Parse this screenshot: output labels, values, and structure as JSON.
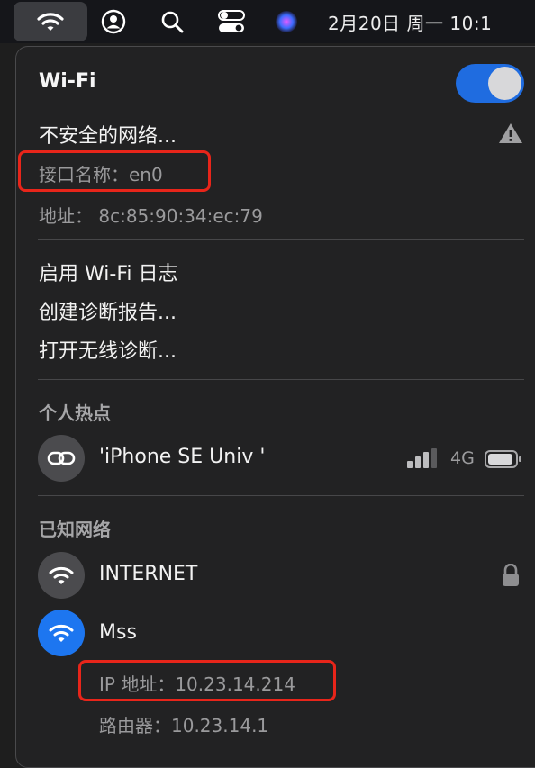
{
  "menubar": {
    "clock": "2月20日 周一  10:1",
    "icons": [
      "wifi-icon",
      "user-icon",
      "search-icon",
      "control-center-icon",
      "siri-icon"
    ]
  },
  "wifi": {
    "title": "Wi-Fi",
    "toggle_on": true,
    "insecure": "不安全的网络...",
    "interface_label": "接口名称：",
    "interface_value": "en0",
    "address_label": "地址：",
    "address_value": "8c:85:90:34:ec:79"
  },
  "actions": [
    {
      "label": "启用 Wi-Fi 日志"
    },
    {
      "label": "创建诊断报告..."
    },
    {
      "label": "打开无线诊断..."
    }
  ],
  "hotspot": {
    "section": "个人热点",
    "name": "'iPhone SE Univ '",
    "network_type": "4G",
    "signal_bars": 3
  },
  "known": {
    "section": "已知网络",
    "networks": [
      {
        "name": "INTERNET",
        "locked": true
      },
      {
        "name": "Mss",
        "connected": true,
        "ip_label": "IP 地址：",
        "ip_value": "10.23.14.214",
        "router_label": "路由器：",
        "router_value": "10.23.14.1"
      }
    ]
  },
  "colors": {
    "accent": "#1d76f0",
    "highlight": "#e8251a"
  }
}
